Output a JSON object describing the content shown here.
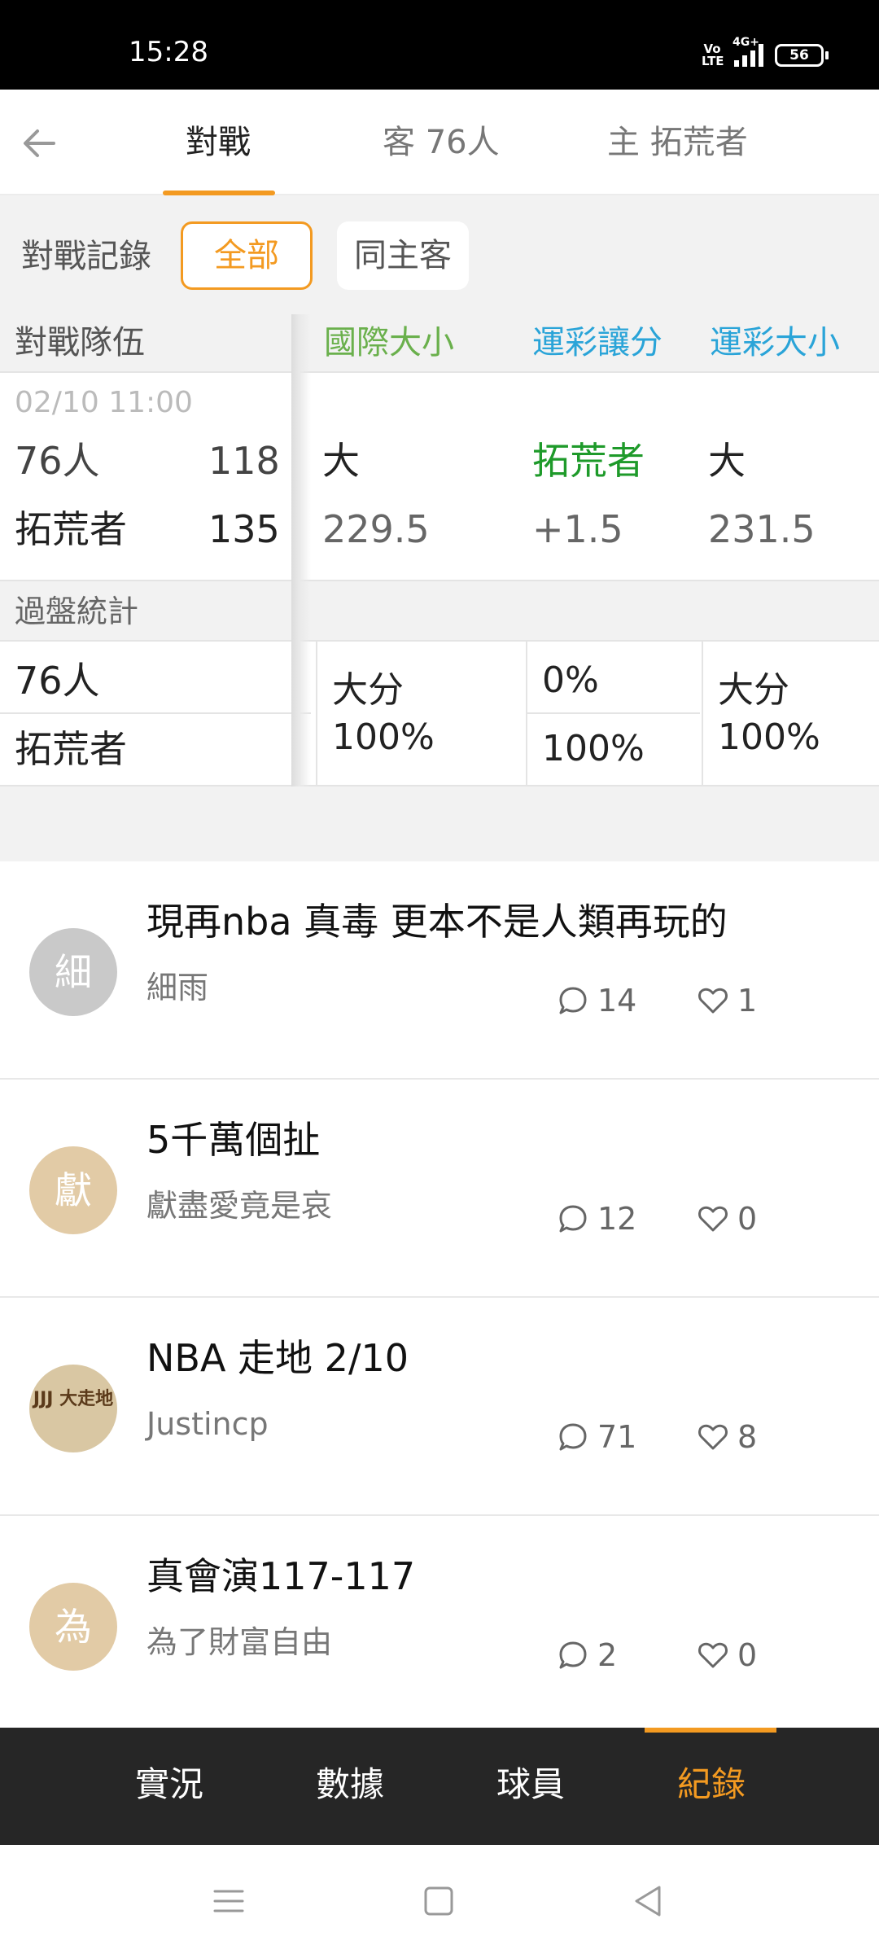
{
  "status_bar": {
    "time": "15:28",
    "volte": "Vo LTE",
    "network": "4G+",
    "battery": "56"
  },
  "tabs": [
    {
      "label": "對戰"
    },
    {
      "label": "客 76人"
    },
    {
      "label": "主 拓荒者"
    }
  ],
  "filter": {
    "label": "對戰記錄",
    "options": [
      "全部",
      "同主客"
    ],
    "selected": "全部"
  },
  "table": {
    "headers": {
      "team": "對戰隊伍",
      "intl_total": "國際大小",
      "spread": "運彩讓分",
      "total": "運彩大小"
    },
    "game": {
      "date": "02/10 11:00",
      "away": {
        "name": "76人",
        "score": "118"
      },
      "home": {
        "name": "拓荒者",
        "score": "135"
      },
      "intl_total": {
        "result": "大",
        "line": "229.5"
      },
      "spread": {
        "result": "拓荒者",
        "line": "+1.5"
      },
      "total": {
        "result": "大",
        "line": "231.5"
      }
    },
    "stats": {
      "title": "過盤統計",
      "team1": "76人",
      "team2": "拓荒者",
      "intl_total": {
        "label": "大分",
        "value": "100%"
      },
      "spread": {
        "team1": "0%",
        "team2": "100%"
      },
      "total": {
        "label": "大分",
        "value": "100%"
      }
    }
  },
  "posts": [
    {
      "title": "現再nba  真毒 更本不是人類再玩的",
      "author": "細雨",
      "avatar_char": "細",
      "avatar_color": "#c9c9c9",
      "comments": "14",
      "likes": "1"
    },
    {
      "title": "5千萬個扯",
      "author": "獻盡愛竟是哀",
      "avatar_char": "獻",
      "avatar_color": "#e2cba6",
      "comments": "12",
      "likes": "0"
    },
    {
      "title": "NBA 走地 2/10",
      "author": "Justincp",
      "avatar_char": "JJJ 大走地",
      "avatar_color": "#d9c7a3",
      "comments": "71",
      "likes": "8"
    },
    {
      "title": "真會演117-117",
      "author": "為了財富自由",
      "avatar_char": "為",
      "avatar_color": "#e2cba6",
      "comments": "2",
      "likes": "0"
    }
  ],
  "bottom_nav": [
    {
      "label": "實況"
    },
    {
      "label": "數據"
    },
    {
      "label": "球員"
    },
    {
      "label": "紀錄"
    }
  ],
  "colors": {
    "accent": "#f39a21",
    "intl_header": "#6ab04c",
    "sport_header": "#2aa4d8",
    "spread_team": "#1e9a2a",
    "nav_bg": "#262626"
  },
  "icons": [
    "back-arrow-icon",
    "comment-icon",
    "heart-icon",
    "menu-icon",
    "home-icon",
    "back-icon"
  ]
}
